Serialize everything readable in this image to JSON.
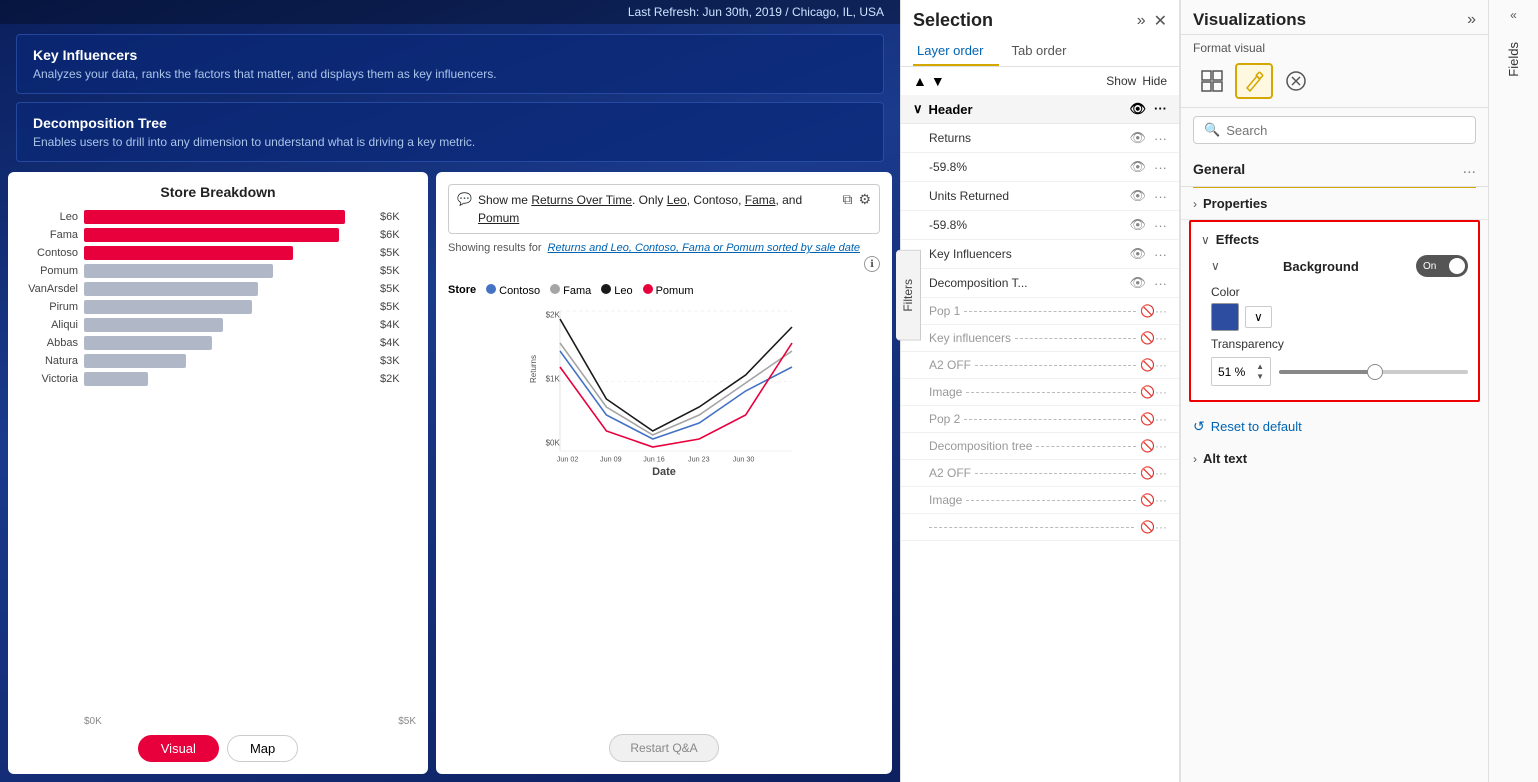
{
  "topBar": {
    "refreshText": "Last Refresh: Jun 30th, 2019 / Chicago, IL, USA"
  },
  "cards": [
    {
      "id": "key-influencers",
      "title": "Key Influencers",
      "description": "Analyzes your data, ranks the factors that matter, and displays them as key influencers."
    },
    {
      "id": "decomposition-tree",
      "title": "Decomposition Tree",
      "description": "Enables users to drill into any dimension to understand what is driving a key metric."
    }
  ],
  "storeBreakdown": {
    "title": "Store Breakdown",
    "bars": [
      {
        "label": "Leo",
        "value": "$6K",
        "pct": 90,
        "type": "red"
      },
      {
        "label": "Fama",
        "value": "$6K",
        "pct": 88,
        "type": "red"
      },
      {
        "label": "Contoso",
        "value": "$5K",
        "pct": 72,
        "type": "red"
      },
      {
        "label": "Pomum",
        "value": "$5K",
        "pct": 65,
        "type": "gray"
      },
      {
        "label": "VanArsdel",
        "value": "$5K",
        "pct": 60,
        "type": "gray"
      },
      {
        "label": "Pirum",
        "value": "$5K",
        "pct": 58,
        "type": "gray"
      },
      {
        "label": "Aliqui",
        "value": "$4K",
        "pct": 48,
        "type": "gray"
      },
      {
        "label": "Abbas",
        "value": "$4K",
        "pct": 44,
        "type": "gray"
      },
      {
        "label": "Natura",
        "value": "$3K",
        "pct": 35,
        "type": "gray"
      },
      {
        "label": "Victoria",
        "value": "$2K",
        "pct": 22,
        "type": "gray"
      }
    ],
    "axisLabels": [
      "$0K",
      "$5K"
    ],
    "tabs": [
      "Visual",
      "Map"
    ]
  },
  "qaPanel": {
    "inputText": "Show me Returns Over Time. Only Leo, Contoso, Fama, and Pomum",
    "underlineWords": [
      "Returns Over Time",
      "Leo",
      "Fama",
      "Pomum"
    ],
    "showingLabel": "Showing results for",
    "showingLink": "Returns and Leo, Contoso, Fama or Pomum sorted by sale date",
    "storeLegendLabel": "Store",
    "stores": [
      {
        "name": "Contoso",
        "color": "#4472c4"
      },
      {
        "name": "Fama",
        "color": "#a5a5a5"
      },
      {
        "name": "Leo",
        "color": "#1a1a1a"
      },
      {
        "name": "Pomum",
        "color": "#e8003d"
      }
    ],
    "xAxisLabel": "Date",
    "xDates": [
      "Jun 02",
      "Jun 09",
      "Jun 16",
      "Jun 23",
      "Jun 30"
    ],
    "yValues": [
      "$2K",
      "$1K",
      "$0K"
    ],
    "restartLabel": "Restart Q&A"
  },
  "selection": {
    "title": "Selection",
    "tabs": [
      "Layer order",
      "Tab order"
    ],
    "activeTab": "Layer order",
    "showLabel": "Show",
    "hideLabel": "Hide",
    "groupHeader": "Header",
    "layers": [
      {
        "name": "Returns",
        "visible": true
      },
      {
        "name": "-59.8%",
        "visible": true
      },
      {
        "name": "Units Returned",
        "visible": true
      },
      {
        "name": "-59.8%",
        "visible": true
      },
      {
        "name": "Key Influencers",
        "visible": true
      },
      {
        "name": "Decomposition T...",
        "visible": true
      }
    ],
    "separators": [
      {
        "name": "Pop 1"
      },
      {
        "name": "Key influencers"
      },
      {
        "name": "A2 OFF"
      },
      {
        "name": "Image"
      },
      {
        "name": "Pop 2"
      },
      {
        "name": "Decomposition tree"
      },
      {
        "name": "A2 OFF"
      },
      {
        "name": "Image"
      }
    ]
  },
  "visualizations": {
    "title": "Visualizations",
    "expandLabel": ">>",
    "formatVisualLabel": "Format visual",
    "icons": [
      {
        "name": "table-icon",
        "symbol": "⊞",
        "active": false
      },
      {
        "name": "paint-icon",
        "symbol": "🖊",
        "active": true
      },
      {
        "name": "hand-icon",
        "symbol": "✋",
        "active": false
      }
    ],
    "search": {
      "placeholder": "Search",
      "value": ""
    },
    "general": {
      "label": "General",
      "dotsLabel": "..."
    },
    "properties": {
      "label": "Properties"
    },
    "effects": {
      "label": "Effects",
      "background": {
        "label": "Background",
        "toggleLabel": "On",
        "toggleOn": true,
        "color": {
          "label": "Color",
          "hex": "#2d4da0"
        },
        "transparency": {
          "label": "Transparency",
          "value": "51",
          "unit": "%"
        }
      }
    },
    "resetLabel": "Reset to default",
    "altText": {
      "label": "Alt text"
    }
  },
  "fields": {
    "label": "Fields"
  },
  "filters": {
    "label": "Filters"
  }
}
